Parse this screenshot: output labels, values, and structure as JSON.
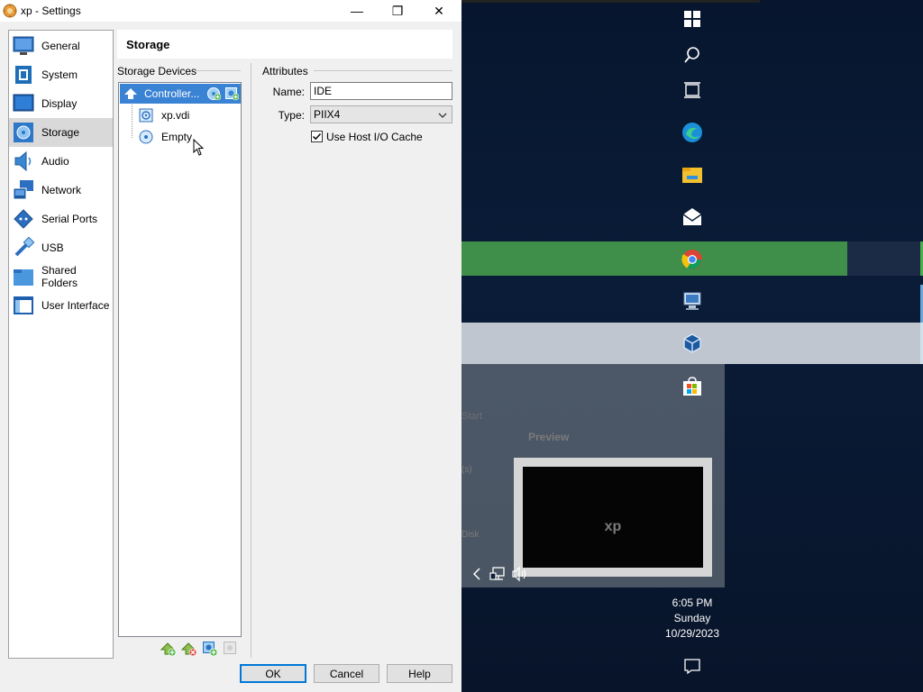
{
  "window": {
    "title": "xp - Settings",
    "controls": {
      "minimize": "—",
      "maximize": "❐",
      "close": "✕"
    }
  },
  "nav": {
    "items": [
      {
        "label": "General",
        "icon": "general-icon"
      },
      {
        "label": "System",
        "icon": "system-icon"
      },
      {
        "label": "Display",
        "icon": "display-icon"
      },
      {
        "label": "Storage",
        "icon": "storage-icon",
        "selected": true
      },
      {
        "label": "Audio",
        "icon": "audio-icon"
      },
      {
        "label": "Network",
        "icon": "network-icon"
      },
      {
        "label": "Serial Ports",
        "icon": "serial-ports-icon"
      },
      {
        "label": "USB",
        "icon": "usb-icon"
      },
      {
        "label": "Shared Folders",
        "icon": "shared-folders-icon"
      },
      {
        "label": "User Interface",
        "icon": "user-interface-icon"
      }
    ]
  },
  "page": {
    "title": "Storage"
  },
  "storage_devices": {
    "group_label": "Storage Devices",
    "controller": {
      "label": "Controller..."
    },
    "attachments": [
      {
        "label": "xp.vdi",
        "icon": "hard-disk-icon"
      },
      {
        "label": "Empty",
        "icon": "optical-disk-icon"
      }
    ]
  },
  "attributes": {
    "group_label": "Attributes",
    "name_label": "Name:",
    "name_value": "IDE",
    "type_label": "Type:",
    "type_value": "PIIX4",
    "host_io_cache_label": "Use Host I/O Cache",
    "host_io_cache_checked": true
  },
  "buttons": {
    "ok": "OK",
    "cancel": "Cancel",
    "help": "Help"
  },
  "desktop": {
    "start_label": "Start",
    "preview_title": "Preview",
    "preview_label": "xp",
    "ghost_text_1": "(s)",
    "ghost_text_2": "Disk"
  },
  "taskbar": {
    "time": "6:05 PM",
    "day": "Sunday",
    "date": "10/29/2023",
    "apps": [
      "windows-start-icon",
      "search-icon",
      "task-view-icon",
      "edge-icon",
      "file-explorer-icon",
      "mail-icon",
      "chrome-icon",
      "remote-desktop-icon",
      "virtualbox-icon",
      "store-icon"
    ]
  },
  "colors": {
    "selection": "#3a82d4",
    "accent": "#0078d7"
  }
}
